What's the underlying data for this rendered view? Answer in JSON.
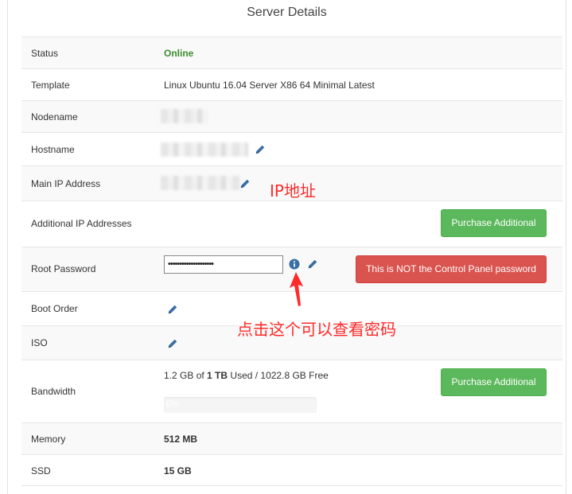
{
  "title": "Server Details",
  "rows": {
    "status": {
      "label": "Status",
      "value": "Online"
    },
    "template": {
      "label": "Template",
      "value": "Linux Ubuntu 16.04 Server X86 64 Minimal Latest"
    },
    "nodename": {
      "label": "Nodename"
    },
    "hostname": {
      "label": "Hostname"
    },
    "main_ip": {
      "label": "Main IP Address"
    },
    "additional_ip": {
      "label": "Additional IP Addresses",
      "button": "Purchase Additional"
    },
    "root_password": {
      "label": "Root Password",
      "value": "••••••••••••••••••••",
      "warning": "This is NOT the Control Panel password"
    },
    "boot_order": {
      "label": "Boot Order"
    },
    "iso": {
      "label": "ISO"
    },
    "bandwidth": {
      "label": "Bandwidth",
      "used": "1.2 GB",
      "of": " of ",
      "total": "1 TB",
      "rest": " Used / 1022.8 GB Free",
      "percent_text": "0%",
      "percent": 0,
      "button": "Purchase Additional"
    },
    "memory": {
      "label": "Memory",
      "value": "512 MB"
    },
    "ssd": {
      "label": "SSD",
      "value": "15 GB"
    }
  },
  "annotations": {
    "ip_note": "IP地址",
    "password_note": "点击这个可以查看密码"
  },
  "colors": {
    "online": "#3c8d2f",
    "green_button": "#5cb85c",
    "red_button": "#d9534f",
    "annotation": "#ff2a2a",
    "icon": "#3a6ea5"
  },
  "icons": [
    "pencil-icon",
    "info-circle-icon",
    "red-arrow"
  ]
}
